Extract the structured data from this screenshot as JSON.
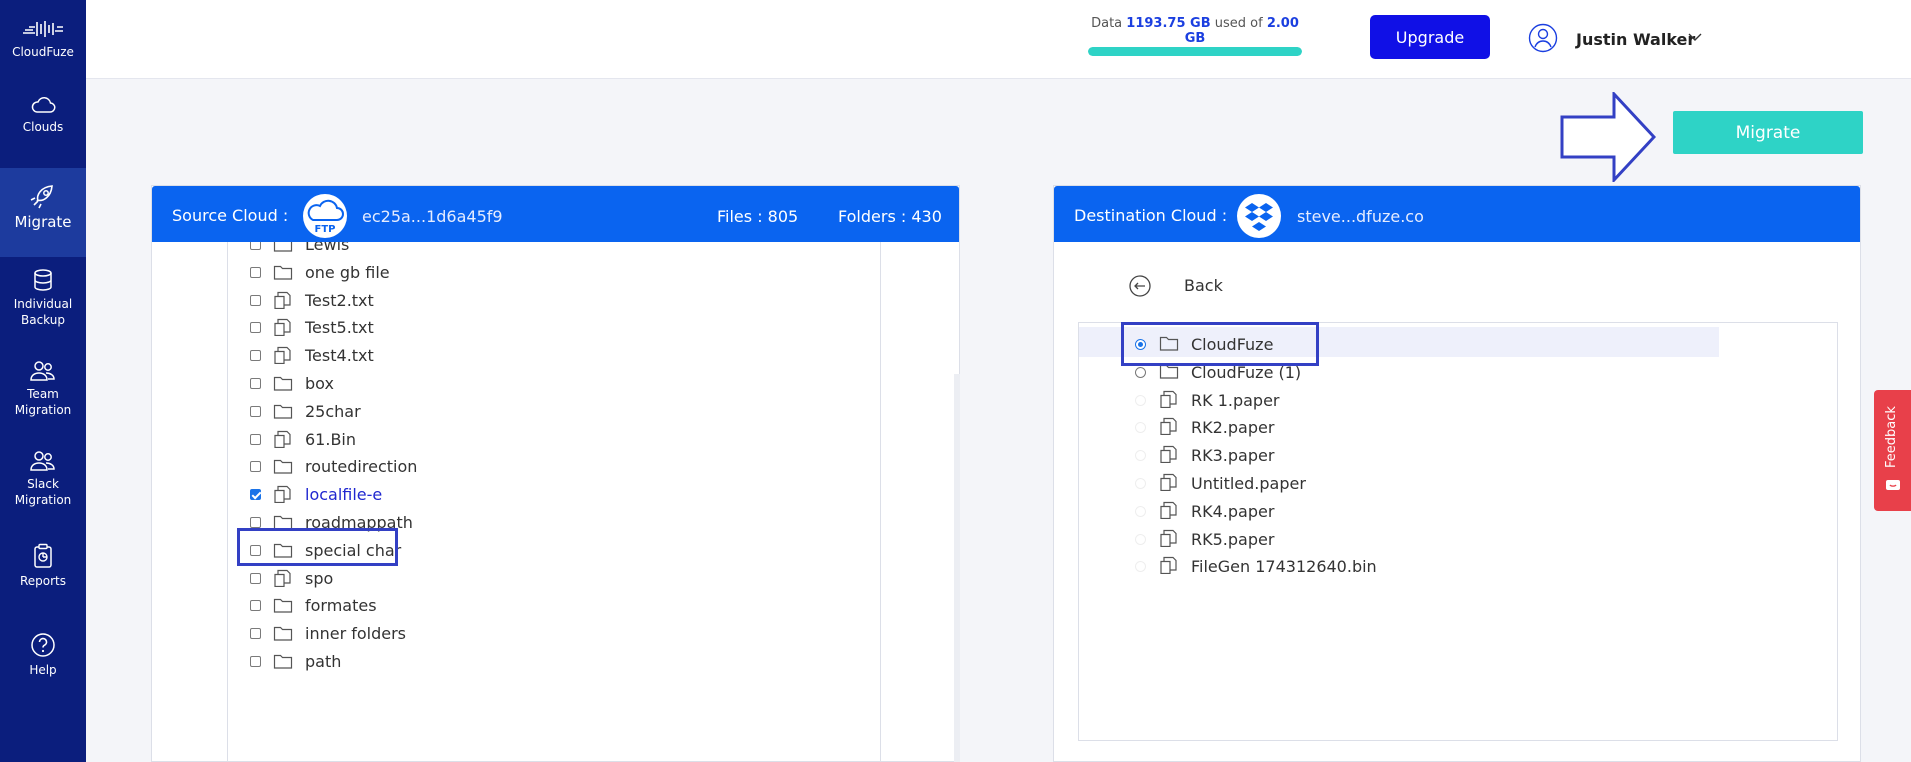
{
  "sidebar": {
    "logo_label": "CloudFuze",
    "items": [
      {
        "label": "Clouds",
        "icon": "cloud-icon"
      },
      {
        "label": "Migrate",
        "icon": "rocket-icon"
      },
      {
        "label_line1": "Individual",
        "label_line2": "Backup",
        "icon": "database-icon"
      },
      {
        "label_line1": "Team",
        "label_line2": "Migration",
        "icon": "team-icon"
      },
      {
        "label_line1": "Slack",
        "label_line2": "Migration",
        "icon": "team-icon"
      },
      {
        "label": "Reports",
        "icon": "report-icon"
      },
      {
        "label": "Help",
        "icon": "help-icon"
      }
    ]
  },
  "header": {
    "usage_prefix": "Data",
    "usage_used": "1193.75 GB",
    "usage_mid": "used of",
    "usage_total": "2.00 GB",
    "usage_fill_percent": 100,
    "upgrade_label": "Upgrade",
    "user_name": "Justin Walker"
  },
  "migrate_label": "Migrate",
  "source": {
    "title": "Source Cloud :",
    "logo": "ftp-icon",
    "account": "ec25a...1d6a45f9",
    "files_text": "Files : 805",
    "folders_text": "Folders : 430",
    "items": [
      {
        "name": "Lewis",
        "type": "folder",
        "checked": false
      },
      {
        "name": "one gb file",
        "type": "folder",
        "checked": false
      },
      {
        "name": "Test2.txt",
        "type": "file",
        "checked": false
      },
      {
        "name": "Test5.txt",
        "type": "file",
        "checked": false
      },
      {
        "name": "Test4.txt",
        "type": "file",
        "checked": false
      },
      {
        "name": "box",
        "type": "folder",
        "checked": false
      },
      {
        "name": "25char",
        "type": "folder",
        "checked": false
      },
      {
        "name": "61.Bin",
        "type": "file",
        "checked": false
      },
      {
        "name": "routedirection",
        "type": "folder",
        "checked": false
      },
      {
        "name": "localfile-e",
        "type": "file",
        "checked": true
      },
      {
        "name": "roadmappath",
        "type": "folder",
        "checked": false
      },
      {
        "name": "special char",
        "type": "folder",
        "checked": false
      },
      {
        "name": "spo",
        "type": "file",
        "checked": false
      },
      {
        "name": "formates",
        "type": "folder",
        "checked": false
      },
      {
        "name": "inner folders",
        "type": "folder",
        "checked": false
      },
      {
        "name": "path",
        "type": "folder",
        "checked": false
      }
    ]
  },
  "destination": {
    "title": "Destination Cloud :",
    "logo": "dropbox-icon",
    "account": "steve...dfuze.co",
    "back_label": "Back",
    "items": [
      {
        "name": "CloudFuze",
        "type": "folder",
        "selected": true
      },
      {
        "name": "CloudFuze (1)",
        "type": "folder",
        "selected": false
      },
      {
        "name": "RK 1.paper",
        "type": "file",
        "selected": false
      },
      {
        "name": "RK2.paper",
        "type": "file",
        "selected": false
      },
      {
        "name": "RK3.paper",
        "type": "file",
        "selected": false
      },
      {
        "name": "Untitled.paper",
        "type": "file",
        "selected": false
      },
      {
        "name": "RK4.paper",
        "type": "file",
        "selected": false
      },
      {
        "name": "RK5.paper",
        "type": "file",
        "selected": false
      },
      {
        "name": "FileGen 174312640.bin",
        "type": "file",
        "selected": false
      }
    ]
  },
  "feedback_label": "Feedback"
}
